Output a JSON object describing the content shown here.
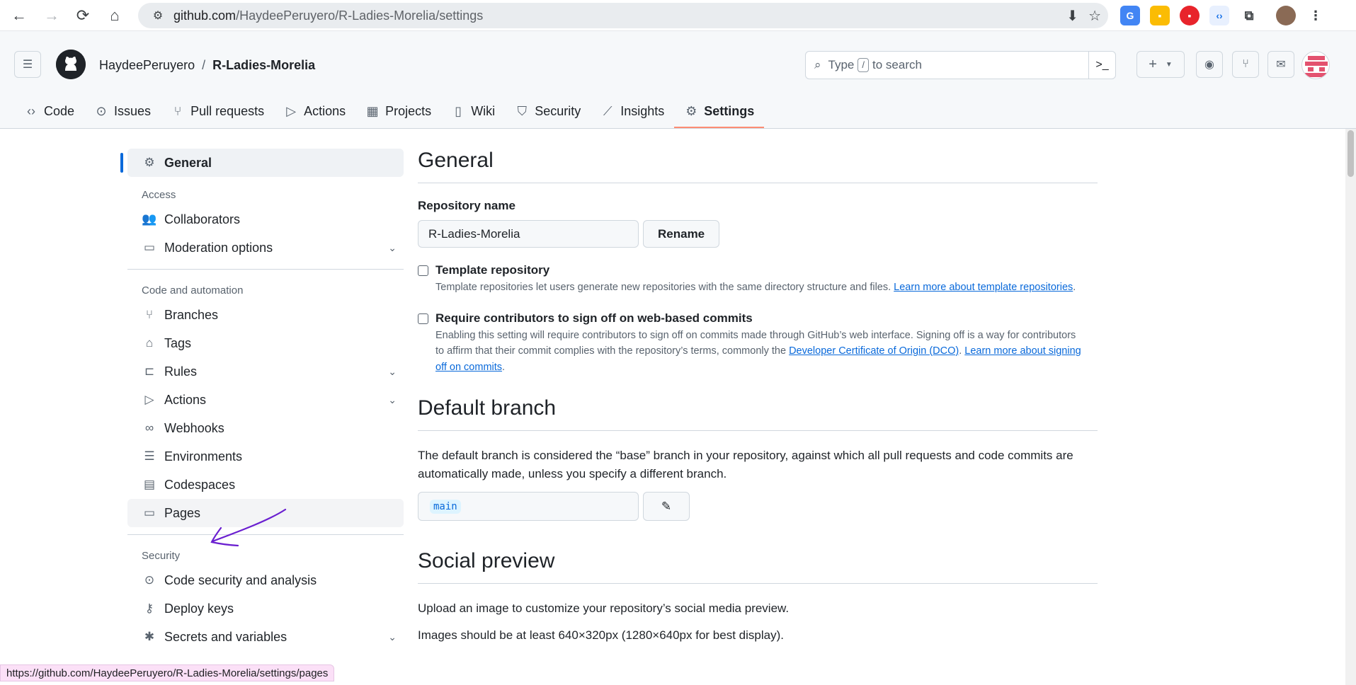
{
  "browser": {
    "url_host": "github.com",
    "url_path": "/HaydeePeruyero/R-Ladies-Morelia/settings"
  },
  "header": {
    "owner": "HaydeePeruyero",
    "separator": "/",
    "repo": "R-Ladies-Morelia",
    "search_prefix": "Type",
    "search_key": "/",
    "search_suffix": "to search",
    "plus_label": "+",
    "tabs": [
      {
        "label": "Code",
        "icon": "code-icon"
      },
      {
        "label": "Issues",
        "icon": "issue-icon"
      },
      {
        "label": "Pull requests",
        "icon": "pull-request-icon"
      },
      {
        "label": "Actions",
        "icon": "play-icon"
      },
      {
        "label": "Projects",
        "icon": "table-icon"
      },
      {
        "label": "Wiki",
        "icon": "book-icon"
      },
      {
        "label": "Security",
        "icon": "shield-icon"
      },
      {
        "label": "Insights",
        "icon": "graph-icon"
      },
      {
        "label": "Settings",
        "icon": "gear-icon",
        "selected": true
      }
    ]
  },
  "sidebar": {
    "general": "General",
    "access_heading": "Access",
    "collaborators": "Collaborators",
    "moderation": "Moderation options",
    "code_heading": "Code and automation",
    "branches": "Branches",
    "tags": "Tags",
    "rules": "Rules",
    "actions": "Actions",
    "webhooks": "Webhooks",
    "environments": "Environments",
    "codespaces": "Codespaces",
    "pages": "Pages",
    "security_heading": "Security",
    "code_security": "Code security and analysis",
    "deploy_keys": "Deploy keys",
    "secrets": "Secrets and variables"
  },
  "main": {
    "general_title": "General",
    "repo_name_label": "Repository name",
    "repo_name_value": "R-Ladies-Morelia",
    "rename_button": "Rename",
    "template_title": "Template repository",
    "template_desc": "Template repositories let users generate new repositories with the same directory structure and files.",
    "template_link": "Learn more about template repositories",
    "signoff_title": "Require contributors to sign off on web-based commits",
    "signoff_desc": "Enabling this setting will require contributors to sign off on commits made through GitHub’s web interface. Signing off is a way for contributors to affirm that their commit complies with the repository’s terms, commonly the",
    "signoff_link1": "Developer Certificate of Origin (DCO)",
    "signoff_link2": "Learn more about signing off on commits",
    "default_branch_title": "Default branch",
    "default_branch_desc": "The default branch is considered the “base” branch in your repository, against which all pull requests and code commits are automatically made, unless you specify a different branch.",
    "default_branch_value": "main",
    "social_title": "Social preview",
    "social_desc1": "Upload an image to customize your repository’s social media preview.",
    "social_desc2": "Images should be at least 640×320px (1280×640px for best display)."
  },
  "status_url": "https://github.com/HaydeePeruyero/R-Ladies-Morelia/settings/pages",
  "colors": {
    "accent": "#0969da",
    "tab_underline": "#fd8c73",
    "annotation": "#6a1fd0"
  }
}
